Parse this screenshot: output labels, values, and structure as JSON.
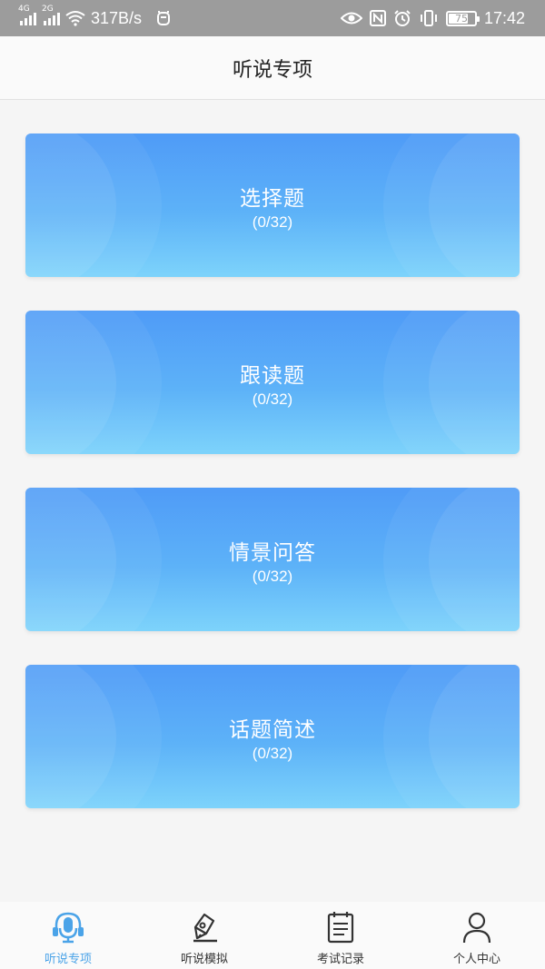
{
  "status_bar": {
    "signal_1_label": "4G",
    "signal_2_label": "2G",
    "speed": "317B/s",
    "battery_level": 75,
    "battery": "75",
    "time": "17:42"
  },
  "header": {
    "title": "听说专项"
  },
  "cards": [
    {
      "title": "选择题",
      "count": "(0/32)"
    },
    {
      "title": "跟读题",
      "count": "(0/32)"
    },
    {
      "title": "情景问答",
      "count": "(0/32)"
    },
    {
      "title": "话题简述",
      "count": "(0/32)"
    }
  ],
  "tabs": [
    {
      "label": "听说专项",
      "icon": "microphone-headset-icon",
      "active": true
    },
    {
      "label": "听说模拟",
      "icon": "pen-icon",
      "active": false
    },
    {
      "label": "考试记录",
      "icon": "clipboard-list-icon",
      "active": false
    },
    {
      "label": "个人中心",
      "icon": "person-icon",
      "active": false
    }
  ],
  "colors": {
    "accent": "#4aa3e8",
    "card_top": "#4f9bf7",
    "card_bottom": "#7dd3fb",
    "status_bar": "#9c9c9c"
  }
}
